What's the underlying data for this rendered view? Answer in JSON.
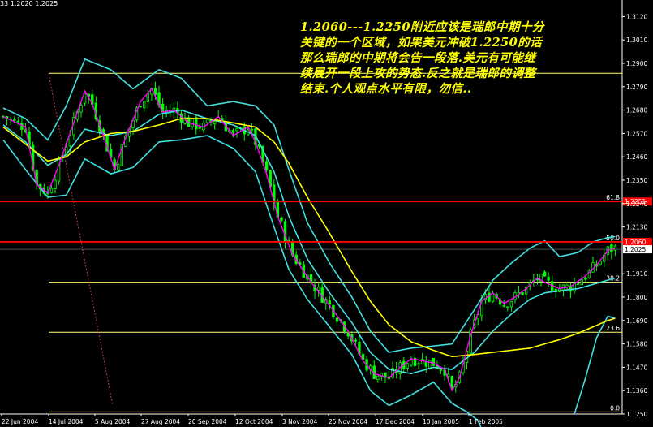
{
  "header": {
    "text": "33 1.2020 1.2025"
  },
  "annotation": "1.2060---1.2250附近应该是瑞郎中期十分\n关键的一个区域，如果美元冲破1.2250的话\n那么瑞郎的中期将会告一段落.美元有可能继\n续展开一段上攻的势态.反之就是瑞郎的调整\n结束.个人观点水平有限，勿信..",
  "colors": {
    "background": "#000000",
    "candles": "#00ff00",
    "bollinger": "#40e0e0",
    "fast_ma": "#ff00ff",
    "slow_ma": "#ffff00",
    "fib": "#ffff80",
    "resistance": "#ff0000",
    "trendline": "#c04040",
    "text": "#ffffff",
    "annotation": "#ffff00"
  },
  "chart_data": {
    "type": "candlestick",
    "x_tick_labels": [
      "22 Jun 2004",
      "14 Jul 2004",
      "5 Aug 2004",
      "27 Aug 2004",
      "20 Sep 2004",
      "12 Oct 2004",
      "3 Nov 2004",
      "25 Nov 2004",
      "17 Dec 2004",
      "10 Jan 2005",
      "1 Feb 2005"
    ],
    "y_tick_labels": [
      "1.3120",
      "1.3010",
      "1.2900",
      "1.2790",
      "1.2680",
      "1.2570",
      "1.2460",
      "1.2350",
      "1.2240",
      "1.2130",
      "1.2025",
      "1.1910",
      "1.1800",
      "1.1690",
      "1.1580",
      "1.1470",
      "1.1360",
      "1.1250"
    ],
    "ylim": [
      1.125,
      1.3175
    ],
    "n_bars": 166,
    "current_price": {
      "label": "1.2025",
      "value": 1.2025
    },
    "horizontal_lines": [
      {
        "kind": "resistance",
        "value": 1.225,
        "label": "1.2251"
      },
      {
        "kind": "resistance",
        "value": 1.206,
        "label": "1.2060"
      }
    ],
    "fibonacci": [
      {
        "label": "61.8",
        "value": 1.225
      },
      {
        "label": "50.0",
        "value": 1.206
      },
      {
        "label": "38.2",
        "value": 1.187
      },
      {
        "label": "23.6",
        "value": 1.1635
      },
      {
        "label": "0.0",
        "value": 1.126
      }
    ],
    "fib_top": {
      "value": 1.2853
    },
    "trendline": {
      "from": [
        0,
        1.285
      ],
      "to": [
        22,
        1.129
      ]
    },
    "keypoints": [
      [
        0,
        1.265
      ],
      [
        6,
        1.26
      ],
      [
        9,
        1.233
      ],
      [
        12,
        1.229
      ],
      [
        15,
        1.242
      ],
      [
        19,
        1.262
      ],
      [
        22,
        1.277
      ],
      [
        24,
        1.271
      ],
      [
        27,
        1.256
      ],
      [
        30,
        1.24
      ],
      [
        33,
        1.255
      ],
      [
        37,
        1.272
      ],
      [
        40,
        1.278
      ],
      [
        43,
        1.267
      ],
      [
        46,
        1.268
      ],
      [
        50,
        1.262
      ],
      [
        54,
        1.26
      ],
      [
        58,
        1.265
      ],
      [
        62,
        1.256
      ],
      [
        66,
        1.26
      ],
      [
        68,
        1.253
      ],
      [
        71,
        1.238
      ],
      [
        74,
        1.218
      ],
      [
        78,
        1.2
      ],
      [
        83,
        1.187
      ],
      [
        88,
        1.176
      ],
      [
        93,
        1.164
      ],
      [
        97,
        1.15
      ],
      [
        100,
        1.144
      ],
      [
        104,
        1.142
      ],
      [
        107,
        1.147
      ],
      [
        110,
        1.151
      ],
      [
        113,
        1.15
      ],
      [
        116,
        1.149
      ],
      [
        119,
        1.146
      ],
      [
        121,
        1.136
      ],
      [
        123,
        1.142
      ],
      [
        126,
        1.162
      ],
      [
        129,
        1.178
      ],
      [
        132,
        1.182
      ],
      [
        135,
        1.177
      ],
      [
        138,
        1.18
      ],
      [
        141,
        1.184
      ],
      [
        144,
        1.189
      ],
      [
        146,
        1.187
      ],
      [
        150,
        1.184
      ],
      [
        153,
        1.185
      ],
      [
        157,
        1.19
      ],
      [
        160,
        1.195
      ],
      [
        163,
        1.202
      ],
      [
        165,
        1.203
      ]
    ],
    "bollinger_period": 20,
    "bollinger_width": 2,
    "fast_ma_period": 5,
    "slow_ma_period": 20,
    "upper_band_keypoints": [
      [
        0,
        1.269
      ],
      [
        6,
        1.264
      ],
      [
        12,
        1.254
      ],
      [
        17,
        1.27
      ],
      [
        22,
        1.292
      ],
      [
        29,
        1.287
      ],
      [
        35,
        1.278
      ],
      [
        42,
        1.287
      ],
      [
        48,
        1.283
      ],
      [
        55,
        1.27
      ],
      [
        62,
        1.272
      ],
      [
        68,
        1.27
      ],
      [
        73,
        1.261
      ],
      [
        77,
        1.24
      ],
      [
        82,
        1.215
      ],
      [
        88,
        1.196
      ],
      [
        94,
        1.18
      ],
      [
        99,
        1.164
      ],
      [
        104,
        1.154
      ],
      [
        110,
        1.156
      ],
      [
        116,
        1.157
      ],
      [
        121,
        1.158
      ],
      [
        127,
        1.174
      ],
      [
        132,
        1.188
      ],
      [
        137,
        1.196
      ],
      [
        142,
        1.203
      ],
      [
        146,
        1.2065
      ],
      [
        150,
        1.199
      ],
      [
        155,
        1.201
      ],
      [
        159,
        1.206
      ],
      [
        163,
        1.208
      ],
      [
        165,
        1.2085
      ]
    ],
    "lower_band_keypoints": [
      [
        0,
        1.254
      ],
      [
        6,
        1.24
      ],
      [
        12,
        1.227
      ],
      [
        17,
        1.228
      ],
      [
        22,
        1.245
      ],
      [
        29,
        1.238
      ],
      [
        35,
        1.241
      ],
      [
        42,
        1.253
      ],
      [
        48,
        1.254
      ],
      [
        55,
        1.256
      ],
      [
        62,
        1.25
      ],
      [
        68,
        1.239
      ],
      [
        73,
        1.213
      ],
      [
        77,
        1.193
      ],
      [
        82,
        1.179
      ],
      [
        88,
        1.166
      ],
      [
        94,
        1.153
      ],
      [
        99,
        1.136
      ],
      [
        104,
        1.129
      ],
      [
        110,
        1.134
      ],
      [
        116,
        1.14
      ],
      [
        121,
        1.13
      ],
      [
        125,
        1.126
      ],
      [
        128,
        1.122
      ],
      [
        131,
        1.11
      ]
    ],
    "lower_band_recovery_keypoints": [
      [
        154,
        1.125
      ],
      [
        157,
        1.142
      ],
      [
        160,
        1.161
      ],
      [
        163,
        1.171
      ],
      [
        165,
        1.17
      ]
    ],
    "middle_band_keypoints": [
      [
        0,
        1.261
      ],
      [
        6,
        1.253
      ],
      [
        12,
        1.242
      ],
      [
        17,
        1.247
      ],
      [
        22,
        1.259
      ],
      [
        29,
        1.256
      ],
      [
        35,
        1.258
      ],
      [
        42,
        1.266
      ],
      [
        48,
        1.268
      ],
      [
        55,
        1.264
      ],
      [
        62,
        1.261
      ],
      [
        68,
        1.256
      ],
      [
        73,
        1.239
      ],
      [
        77,
        1.218
      ],
      [
        82,
        1.198
      ],
      [
        88,
        1.182
      ],
      [
        94,
        1.168
      ],
      [
        99,
        1.154
      ],
      [
        104,
        1.146
      ],
      [
        110,
        1.144
      ],
      [
        116,
        1.147
      ],
      [
        121,
        1.146
      ],
      [
        127,
        1.154
      ],
      [
        132,
        1.164
      ],
      [
        137,
        1.172
      ],
      [
        142,
        1.179
      ],
      [
        146,
        1.182
      ],
      [
        150,
        1.183
      ],
      [
        155,
        1.184
      ],
      [
        159,
        1.186
      ],
      [
        163,
        1.188
      ],
      [
        165,
        1.189
      ]
    ],
    "slow_ma_keypoints": [
      [
        0,
        1.26
      ],
      [
        6,
        1.252
      ],
      [
        12,
        1.244
      ],
      [
        17,
        1.246
      ],
      [
        22,
        1.253
      ],
      [
        29,
        1.257
      ],
      [
        35,
        1.258
      ],
      [
        42,
        1.261
      ],
      [
        48,
        1.264
      ],
      [
        55,
        1.264
      ],
      [
        62,
        1.262
      ],
      [
        68,
        1.26
      ],
      [
        73,
        1.253
      ],
      [
        77,
        1.243
      ],
      [
        82,
        1.227
      ],
      [
        88,
        1.21
      ],
      [
        94,
        1.192
      ],
      [
        99,
        1.178
      ],
      [
        104,
        1.167
      ],
      [
        110,
        1.159
      ],
      [
        116,
        1.155
      ],
      [
        121,
        1.152
      ],
      [
        127,
        1.153
      ],
      [
        132,
        1.154
      ],
      [
        137,
        1.155
      ],
      [
        142,
        1.156
      ],
      [
        146,
        1.158
      ],
      [
        150,
        1.16
      ],
      [
        155,
        1.163
      ],
      [
        159,
        1.166
      ],
      [
        163,
        1.169
      ],
      [
        165,
        1.17
      ]
    ]
  }
}
